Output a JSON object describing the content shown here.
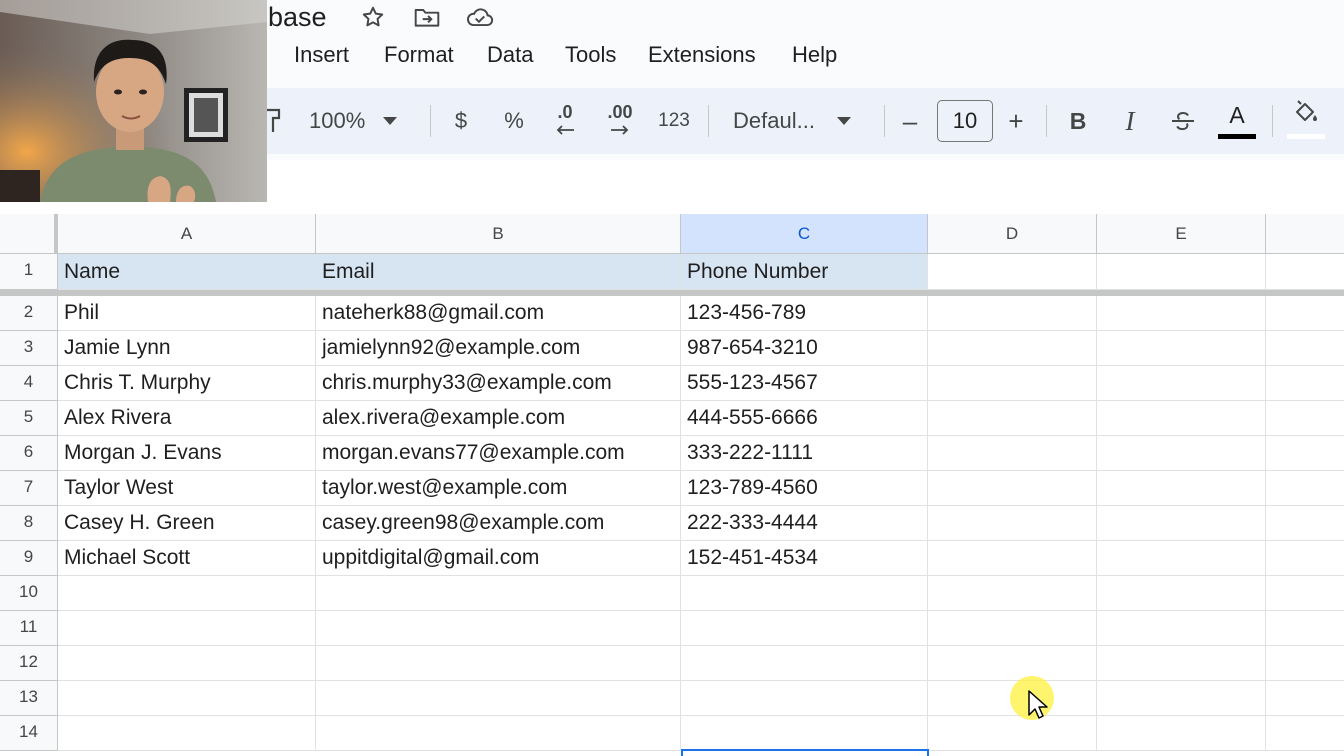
{
  "title_bar": {
    "title_fragment": "base",
    "icons": [
      "star-icon",
      "move-to-folder-icon",
      "cloud-status-icon"
    ]
  },
  "menu": {
    "items": [
      "Insert",
      "Format",
      "Data",
      "Tools",
      "Extensions",
      "Help"
    ]
  },
  "toolbar": {
    "zoom": "100%",
    "currency": "$",
    "percent": "%",
    "decrease_decimal": ".0",
    "increase_decimal": ".00",
    "number_format": "123",
    "font": "Defaul...",
    "decrease_font_size": "–",
    "font_size": "10",
    "increase_font_size": "+",
    "bold": "B",
    "italic": "I",
    "text_color_label": "A",
    "text_color": "#000000",
    "fill_color": "#ffffff"
  },
  "sheet": {
    "columns": [
      "A",
      "B",
      "C",
      "D",
      "E"
    ],
    "selected_column": "C",
    "rows": [
      {
        "num": "1",
        "cells": [
          "Name",
          "Email",
          "Phone Number",
          "",
          ""
        ]
      },
      {
        "num": "2",
        "cells": [
          "Phil",
          "nateherk88@gmail.com",
          "123-456-789",
          "",
          ""
        ]
      },
      {
        "num": "3",
        "cells": [
          "Jamie Lynn",
          "jamielynn92@example.com",
          "987-654-3210",
          "",
          ""
        ]
      },
      {
        "num": "4",
        "cells": [
          "Chris T. Murphy",
          "chris.murphy33@example.com",
          "555-123-4567",
          "",
          ""
        ]
      },
      {
        "num": "5",
        "cells": [
          "Alex Rivera",
          "alex.rivera@example.com",
          "444-555-6666",
          "",
          ""
        ]
      },
      {
        "num": "6",
        "cells": [
          "Morgan J. Evans",
          "morgan.evans77@example.com",
          "333-222-1111",
          "",
          ""
        ]
      },
      {
        "num": "7",
        "cells": [
          "Taylor West",
          "taylor.west@example.com",
          "123-789-4560",
          "",
          ""
        ]
      },
      {
        "num": "8",
        "cells": [
          "Casey H. Green",
          "casey.green98@example.com",
          "222-333-4444",
          "",
          ""
        ]
      },
      {
        "num": "9",
        "cells": [
          "Michael Scott",
          "uppitdigital@gmail.com",
          "152-451-4534",
          "",
          ""
        ]
      },
      {
        "num": "10",
        "cells": [
          "",
          "",
          "",
          "",
          ""
        ]
      },
      {
        "num": "11",
        "cells": [
          "",
          "",
          "",
          "",
          ""
        ]
      },
      {
        "num": "12",
        "cells": [
          "",
          "",
          "",
          "",
          ""
        ]
      },
      {
        "num": "13",
        "cells": [
          "",
          "",
          "",
          "",
          ""
        ]
      },
      {
        "num": "14",
        "cells": [
          "",
          "",
          "",
          "",
          ""
        ]
      }
    ]
  },
  "colors": {
    "header_row_fill": "#d7e5f2",
    "selection_accent": "#1a73e8",
    "toolbar_background": "#edf2fa",
    "cursor_highlight": "#fff03c"
  }
}
